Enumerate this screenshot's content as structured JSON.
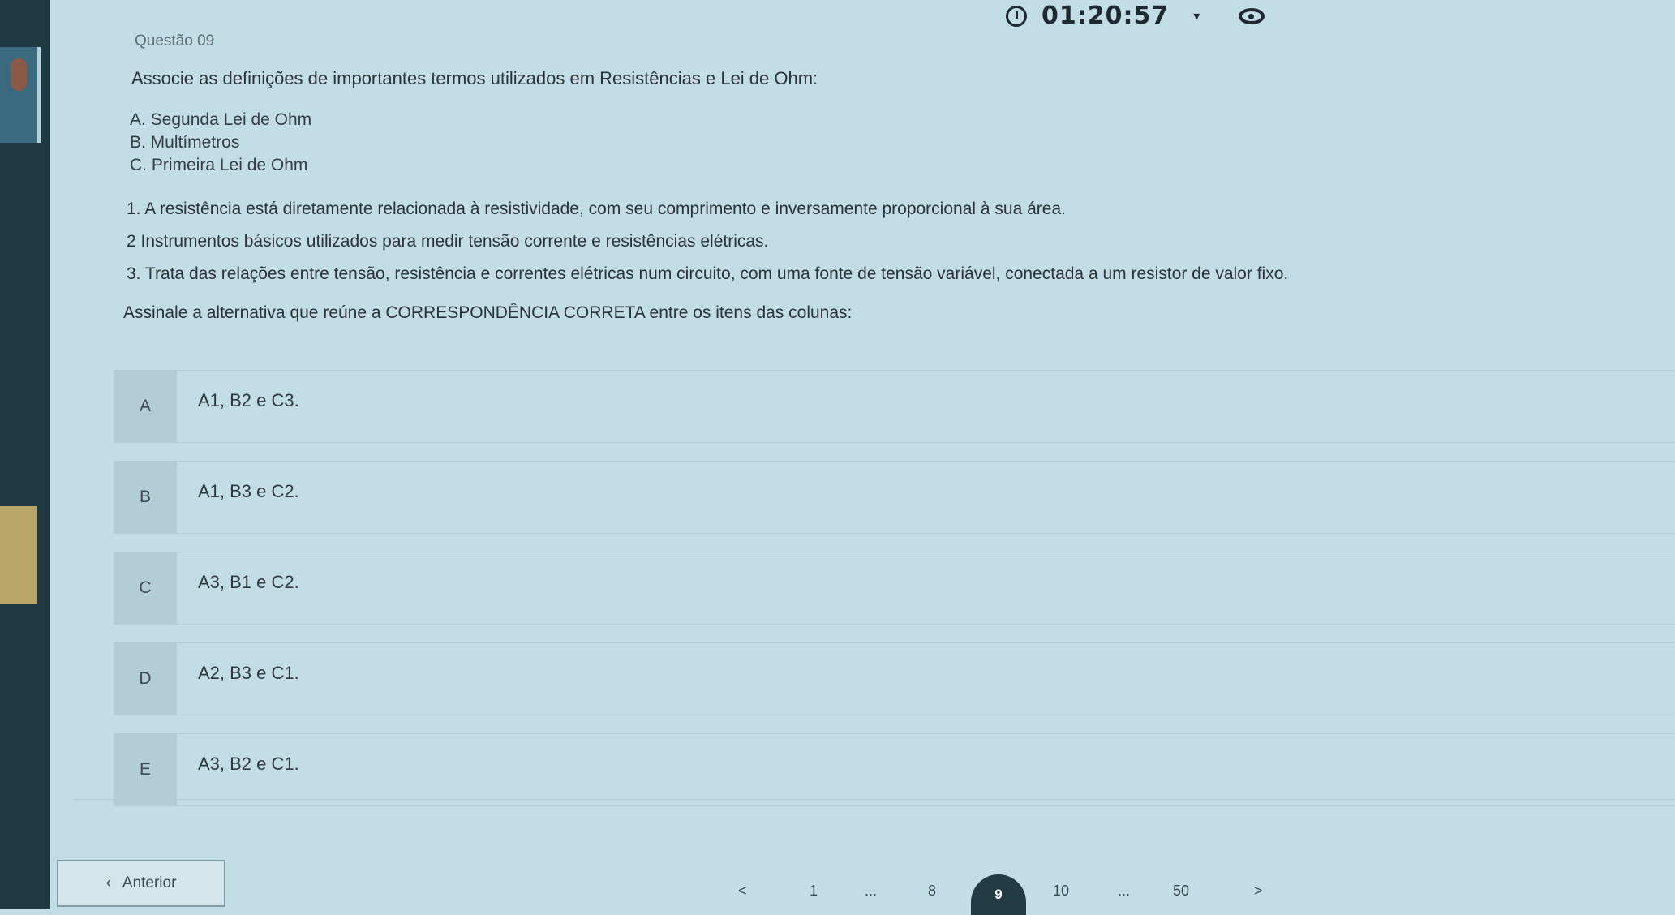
{
  "timer": {
    "value": "01:20:57"
  },
  "question": {
    "number": "Questão 09",
    "stem": "Associe as definições de importantes termos utilizados em Resistências e Lei de Ohm:",
    "column_items": [
      "A. Segunda Lei de Ohm",
      "B. Multímetros",
      "C. Primeira Lei de Ohm"
    ],
    "definitions": [
      "1. A resistência está diretamente relacionada à resistividade, com seu comprimento e inversamente proporcional à sua área.",
      "2 Instrumentos básicos utilizados para medir tensão corrente e resistências elétricas.",
      "3. Trata das relações entre tensão, resistência e correntes elétricas num circuito, com uma fonte de tensão variável, conectada a um resistor de valor fixo."
    ],
    "instruction": "Assinale a alternativa que reúne a CORRESPONDÊNCIA CORRETA entre os itens das colunas:"
  },
  "options": [
    {
      "letter": "A",
      "text": "A1, B2 e C3."
    },
    {
      "letter": "B",
      "text": "A1, B3 e C2."
    },
    {
      "letter": "C",
      "text": "A3, B1 e C2."
    },
    {
      "letter": "D",
      "text": "A2, B3 e C1."
    },
    {
      "letter": "E",
      "text": "A3, B2 e C1."
    }
  ],
  "navigation": {
    "prev_label": "Anterior",
    "prev_icon": "chevron-left-icon",
    "pages": {
      "first": "1",
      "ellipsis_1": "...",
      "p8": "8",
      "current": "9",
      "p10": "10",
      "ellipsis_2": "...",
      "last": "50"
    },
    "prev_arrow": "<",
    "next_arrow": ">"
  }
}
